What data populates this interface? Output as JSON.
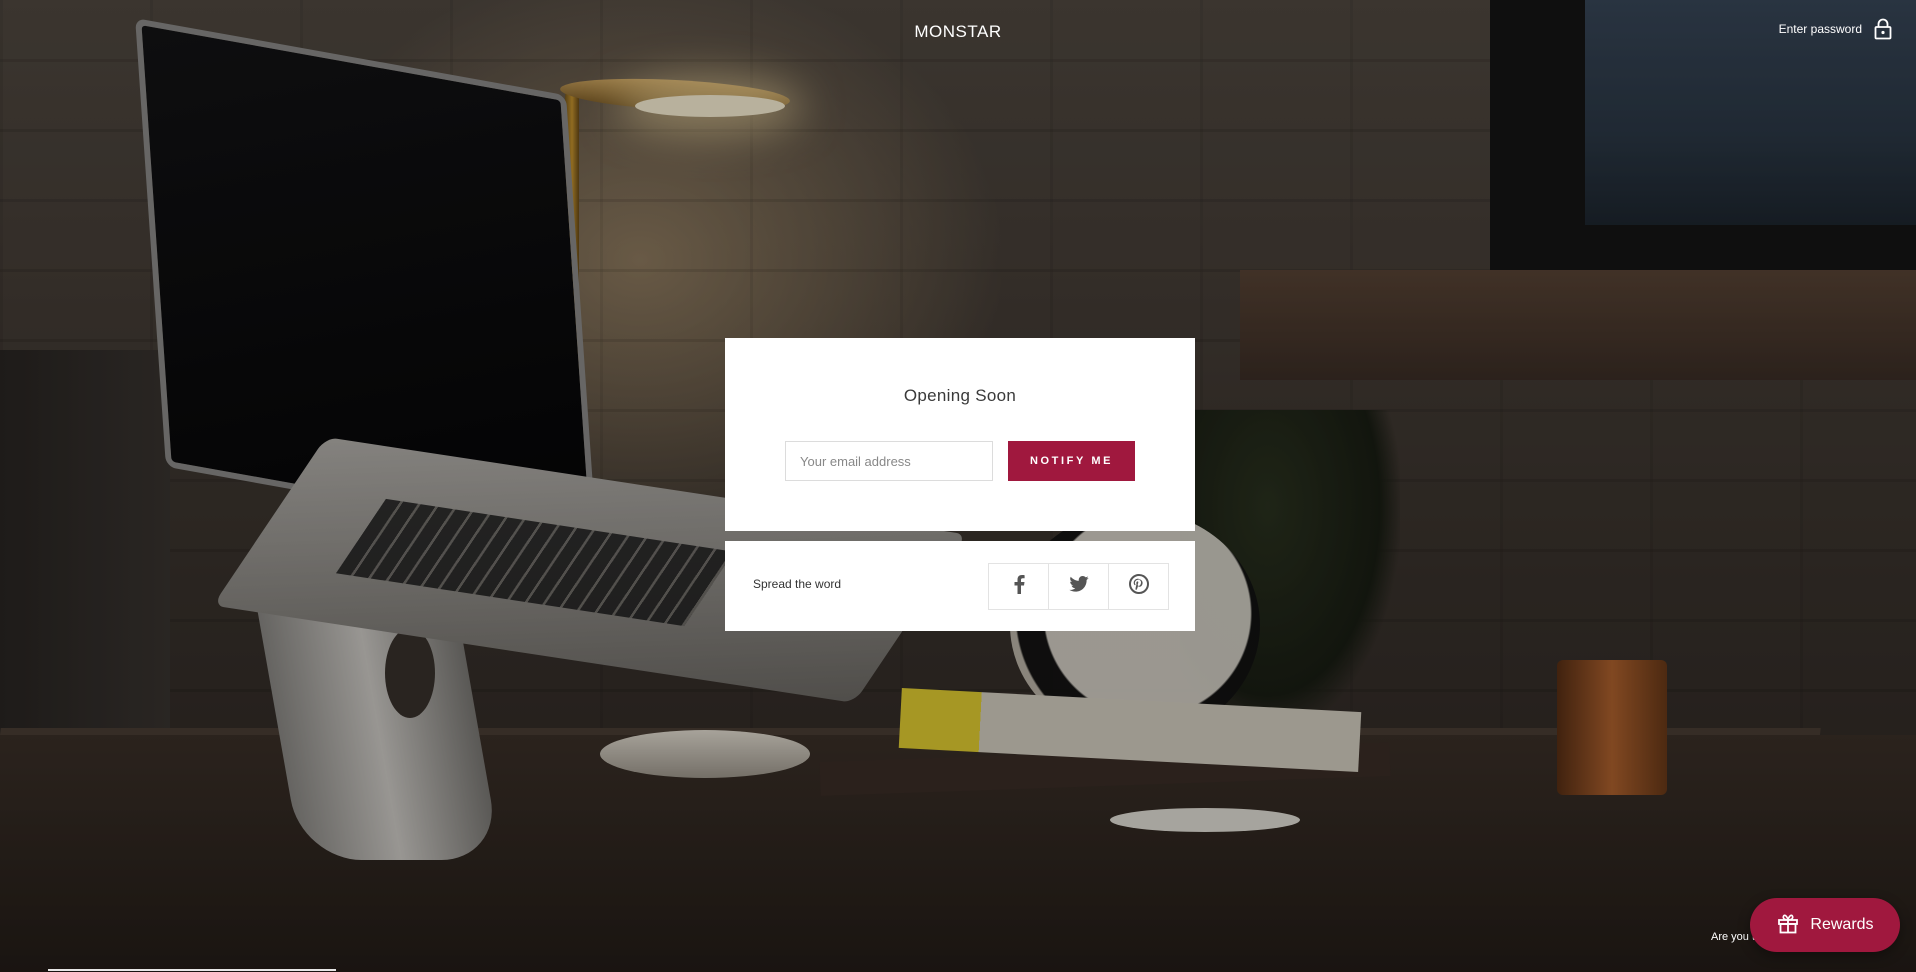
{
  "header": {
    "brand": "MONSTAR",
    "password_link": "Enter password"
  },
  "signup": {
    "title": "Opening Soon",
    "email_placeholder": "Your email address",
    "email_value": "",
    "button_label": "NOTIFY ME"
  },
  "share": {
    "label": "Spread the word",
    "icons": [
      "facebook-icon",
      "twitter-icon",
      "pinterest-icon"
    ]
  },
  "footer": {
    "partial_text": "Are you t",
    "rewards_label": "Rewards"
  },
  "colors": {
    "accent": "#a0183e",
    "card": "#ffffff",
    "text": "#ffffff"
  }
}
